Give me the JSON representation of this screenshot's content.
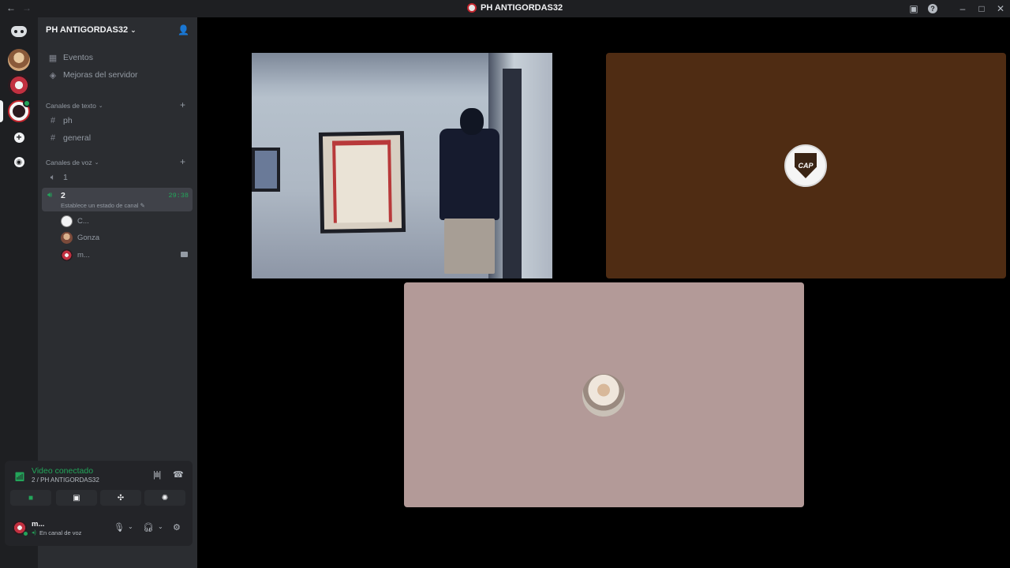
{
  "window": {
    "title": "PH ANTIGORDAS32",
    "back_arrow": "←",
    "forward_arrow": "→",
    "minimize": "–",
    "maximize": "□",
    "close": "✕",
    "help": "?"
  },
  "server": {
    "name": "PH ANTIGORDAS32",
    "chevron": "⌄"
  },
  "top_items": [
    {
      "label": "Eventos",
      "icon": "calendar-icon"
    },
    {
      "label": "Mejoras del servidor",
      "icon": "boost-icon"
    }
  ],
  "text_category": {
    "label": "Canales de texto",
    "add": "+"
  },
  "text_channels": [
    {
      "label": "ph"
    },
    {
      "label": "general"
    }
  ],
  "voice_category": {
    "label": "Canales de voz",
    "add": "+"
  },
  "voice_channels": [
    {
      "label": "1"
    },
    {
      "label": "2",
      "timer": "29:38",
      "status": "Establece un estado de canal ✎"
    }
  ],
  "voice_members": [
    {
      "name": "C..."
    },
    {
      "name": "Gonza"
    },
    {
      "name": "m..."
    }
  ],
  "voice_connection": {
    "title": "Video conectado",
    "subtitle": "2 / PH ANTIGORDAS32"
  },
  "user": {
    "name": "m...",
    "status": "En canal de voz"
  },
  "tiles": {
    "cap_text": "CAP"
  },
  "colors": {
    "accent_green": "#23a55a",
    "sidebar_bg": "#2b2d31",
    "tile_brown": "#4f2c13",
    "tile_pink": "#b39a98"
  }
}
